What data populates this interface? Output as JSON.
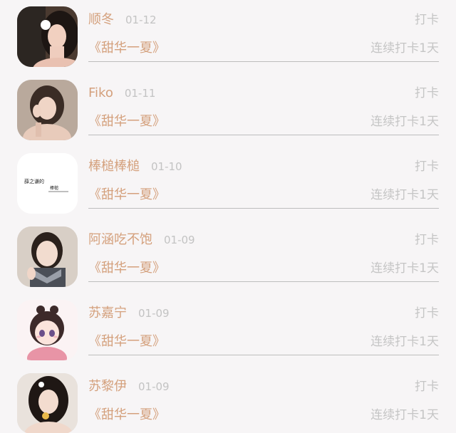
{
  "checkins": [
    {
      "name": "顺冬",
      "date": "01-12",
      "action": "打卡",
      "book": "《甜华一夏》",
      "streak": "连续打卡1天",
      "avatar": "photo"
    },
    {
      "name": "Fiko",
      "date": "01-11",
      "action": "打卡",
      "book": "《甜华一夏》",
      "streak": "连续打卡1天",
      "avatar": "photo"
    },
    {
      "name": "棒槌棒槌",
      "date": "01-10",
      "action": "打卡",
      "book": "《甜华一夏》",
      "streak": "连续打卡1天",
      "avatar": "text",
      "avatar_text": {
        "line1": "薛之谦的",
        "line2": "棒槌"
      }
    },
    {
      "name": "阿涵吃不饱",
      "date": "01-09",
      "action": "打卡",
      "book": "《甜华一夏》",
      "streak": "连续打卡1天",
      "avatar": "photo"
    },
    {
      "name": "苏嘉宁",
      "date": "01-09",
      "action": "打卡",
      "book": "《甜华一夏》",
      "streak": "连续打卡1天",
      "avatar": "cartoon"
    },
    {
      "name": "苏黎伊",
      "date": "01-09",
      "action": "打卡",
      "book": "《甜华一夏》",
      "streak": "连续打卡1天",
      "avatar": "photo"
    }
  ]
}
